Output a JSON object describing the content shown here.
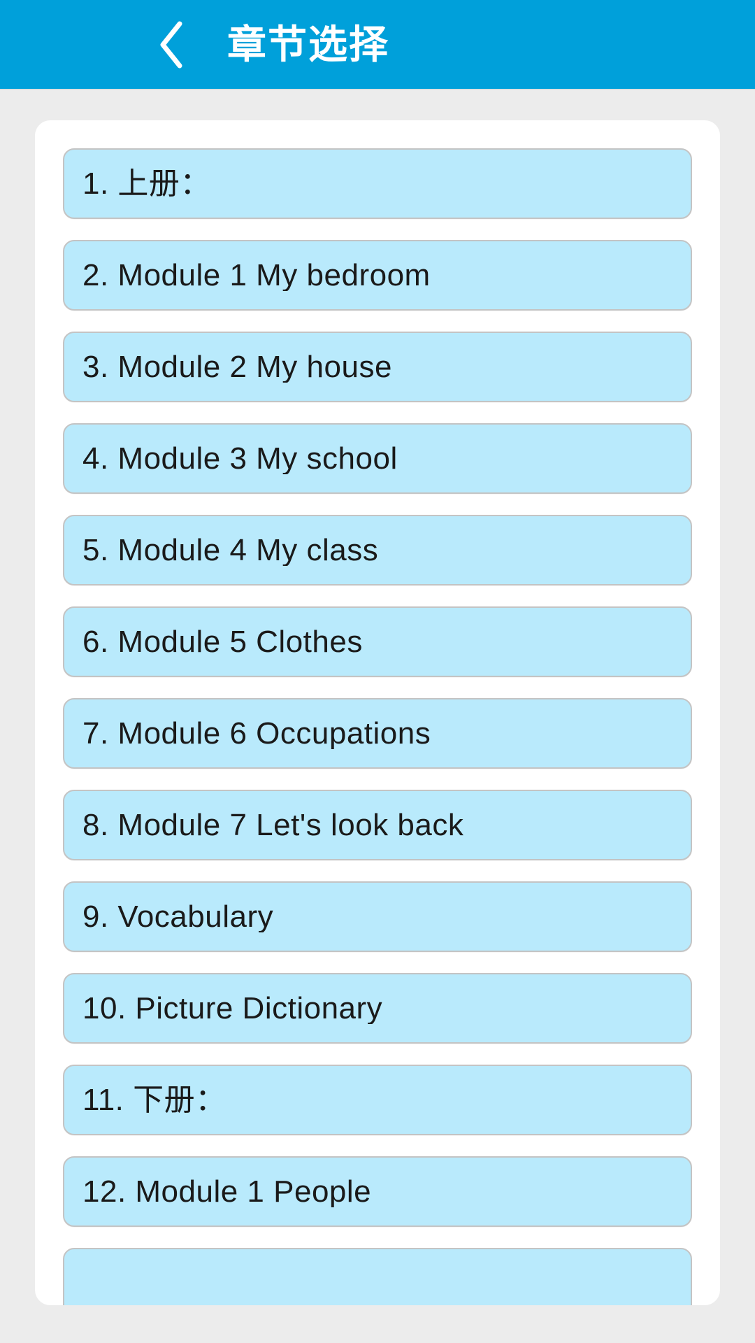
{
  "header": {
    "title": "章节选择",
    "back_icon": "chevron-left-icon",
    "background_color": "#00a0da",
    "title_color": "#ffffff"
  },
  "theme": {
    "page_background": "#ececec",
    "card_background": "#ffffff",
    "item_background": "#b9eafc",
    "item_border": "#c4c4c4",
    "item_text": "#1a1a1a"
  },
  "chapter_list": {
    "items": [
      {
        "label": "1. 上册："
      },
      {
        "label": "2. Module 1 My bedroom"
      },
      {
        "label": "3. Module 2 My house"
      },
      {
        "label": "4. Module 3 My school"
      },
      {
        "label": "5. Module 4 My class"
      },
      {
        "label": "6. Module 5 Clothes"
      },
      {
        "label": "7. Module 6 Occupations"
      },
      {
        "label": "8. Module 7 Let's look back"
      },
      {
        "label": "9. Vocabulary"
      },
      {
        "label": "10. Picture Dictionary"
      },
      {
        "label": "11. 下册："
      },
      {
        "label": "12. Module 1 People"
      },
      {
        "label": ""
      }
    ]
  }
}
